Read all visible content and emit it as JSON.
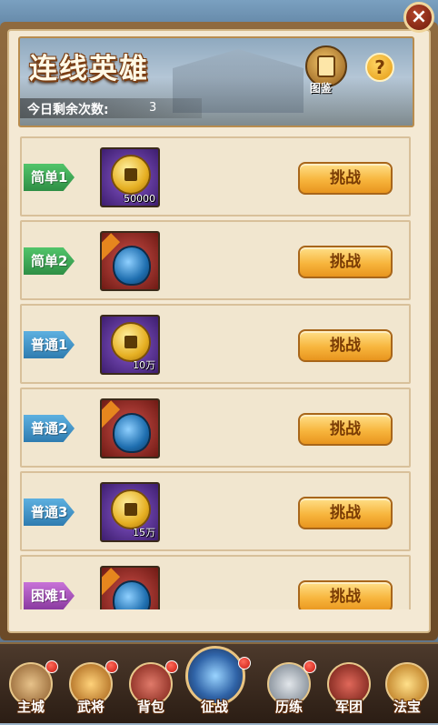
{
  "window": {
    "close_icon": "close-x-icon"
  },
  "banner": {
    "title": "连线英雄",
    "remaining_label": "今日剩余次数:",
    "remaining_value": "3",
    "codex_label": "图鉴",
    "help_label": "?"
  },
  "levels": [
    {
      "tag": "简单1",
      "tag_color": "green",
      "reward": "coin",
      "qty": "50000",
      "button": "挑战"
    },
    {
      "tag": "简单2",
      "tag_color": "green",
      "reward": "bag",
      "qty": "",
      "button": "挑战"
    },
    {
      "tag": "普通1",
      "tag_color": "blue",
      "reward": "coin",
      "qty": "10万",
      "button": "挑战"
    },
    {
      "tag": "普通2",
      "tag_color": "blue",
      "reward": "bag",
      "qty": "",
      "button": "挑战"
    },
    {
      "tag": "普通3",
      "tag_color": "blue",
      "reward": "coin",
      "qty": "15万",
      "button": "挑战"
    },
    {
      "tag": "困难1",
      "tag_color": "purple",
      "reward": "bag",
      "qty": "",
      "button": "挑战"
    }
  ],
  "bottom_nav": [
    {
      "label": "主城",
      "icon": "castle-icon",
      "badge": true
    },
    {
      "label": "武将",
      "icon": "general-icon",
      "badge": true
    },
    {
      "label": "背包",
      "icon": "bag-icon",
      "badge": true
    },
    {
      "label": "征战",
      "icon": "battle-icon",
      "badge": true
    },
    {
      "label": "历练",
      "icon": "training-icon",
      "badge": true
    },
    {
      "label": "军团",
      "icon": "legion-icon",
      "badge": false
    },
    {
      "label": "法宝",
      "icon": "treasure-icon",
      "badge": false
    }
  ]
}
